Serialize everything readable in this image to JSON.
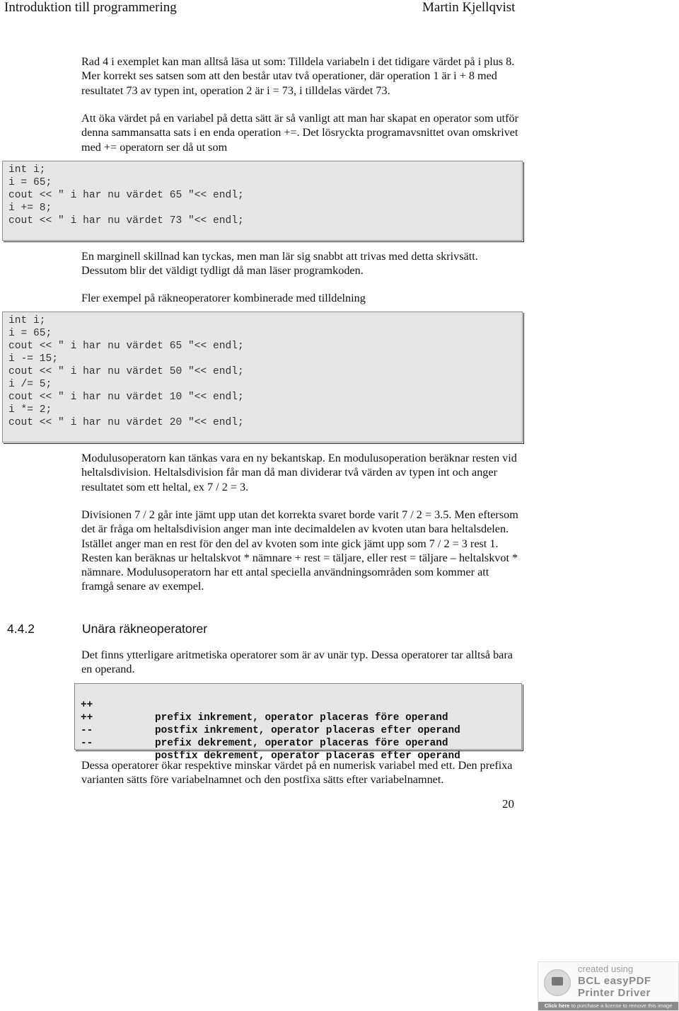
{
  "header": {
    "left": "Introduktion till programmering",
    "right": "Martin Kjellqvist"
  },
  "paragraphs": {
    "p1": "Rad 4 i exemplet kan man alltså läsa ut som: Tilldela variabeln i det tidigare värdet på i plus 8. Mer korrekt ses satsen som att den består utav två operationer, där operation 1 är i + 8 med resultatet 73 av typen int, operation 2 är i = 73, i tilldelas värdet 73.",
    "p2": "Att öka värdet på en variabel på detta sätt är så vanligt att man har skapat en operator som utför denna sammansatta sats i en enda operation +=. Det lösryckta programavsnittet ovan omskrivet med += operatorn ser då ut som",
    "p3": "En marginell skillnad kan tyckas, men man lär sig snabbt att trivas med detta skrivsätt. Dessutom blir det väldigt tydligt då man läser programkoden.",
    "p4": "Fler exempel på räkneoperatorer kombinerade med tilldelning",
    "p5": "Modulusoperatorn kan tänkas vara en ny bekantskap. En modulusoperation beräknar resten vid heltalsdivision. Heltalsdivision får man då man dividerar två värden av typen int och anger resultatet som ett heltal, ex 7 / 2 = 3.",
    "p6": "Divisionen 7 / 2 går inte jämt upp utan det korrekta svaret borde varit 7 / 2 = 3.5. Men eftersom det är fråga om heltalsdivision anger man inte decimaldelen av kvoten utan bara heltalsdelen. Istället anger man en rest för den del av kvoten som inte gick jämt upp som 7 / 2 = 3 rest 1. Resten kan beräknas ur heltalskvot * nämnare + rest = täljare, eller rest = täljare – heltalskvot * nämnare. Modulusoperatorn har ett antal speciella användningsområden som kommer att framgå senare av exempel.",
    "p7": "Det finns ytterligare aritmetiska operatorer som är av unär typ. Dessa operatorer tar alltså bara en operand.",
    "p8": "Dessa operatorer ökar respektive minskar värdet på en numerisk variabel med ett. Den prefixa varianten sätts före variabelnamnet och den postfixa sätts efter variabelnamnet."
  },
  "code1": [
    "int i;",
    "i = 65;",
    "cout << \" i har nu värdet 65 \"<< endl;",
    "i += 8;",
    "cout << \" i har nu värdet 73 \"<< endl;"
  ],
  "code2": [
    "int i;",
    "i = 65;",
    "cout << \" i har nu värdet 65 \"<< endl;",
    "i -= 15;",
    "cout << \" i har nu värdet 50 \"<< endl;",
    "i /= 5;",
    "cout << \" i har nu värdet 10 \"<< endl;",
    "i *= 2;",
    "cout << \" i har nu värdet 20 \"<< endl;"
  ],
  "section": {
    "number": "4.4.2",
    "title": "Unära räkneoperatorer"
  },
  "operators": [
    {
      "op": "++",
      "desc": "prefix inkrement, operator placeras före operand"
    },
    {
      "op": "++",
      "desc": "postfix inkrement, operator placeras efter operand"
    },
    {
      "op": "--",
      "desc": "prefix dekrement, operator placeras före operand"
    },
    {
      "op": "--",
      "desc": "postfix dekrement, operator placeras efter operand"
    }
  ],
  "page_number": "20",
  "watermark": {
    "line1": "created using",
    "line2": "BCL easyPDF",
    "line3": "Printer Driver",
    "bar_bold": "Click here",
    "bar_rest": " to purchase a license to remove this image"
  }
}
